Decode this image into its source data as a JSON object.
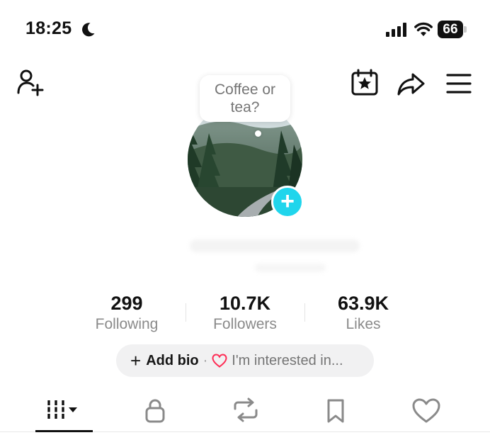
{
  "status_bar": {
    "time": "18:25",
    "battery": "66",
    "icons": [
      "moon-icon",
      "signal-icon",
      "wifi-icon",
      "battery-icon"
    ]
  },
  "header": {
    "icons": [
      "add-friend-icon",
      "calendar-star-icon",
      "share-icon",
      "menu-icon"
    ]
  },
  "profile": {
    "bubble_line1": "Coffee or",
    "bubble_line2": "tea?",
    "avatar_add": "+"
  },
  "stats": {
    "following_count": "299",
    "following_label": "Following",
    "followers_count": "10.7K",
    "followers_label": "Followers",
    "likes_count": "63.9K",
    "likes_label": "Likes"
  },
  "bio": {
    "plus": "+",
    "add_bio": "Add bio",
    "separator": "·",
    "interest": "I'm interested in..."
  },
  "tabs": {
    "items": [
      "videos-grid-icon",
      "lock-icon",
      "repost-icon",
      "bookmark-icon",
      "heart-icon"
    ],
    "active_index": 0
  },
  "colors": {
    "accent_cyan": "#20d5ec",
    "heart_pink": "#fe2c55",
    "text_primary": "#111111",
    "text_secondary": "#8a8a8a"
  }
}
